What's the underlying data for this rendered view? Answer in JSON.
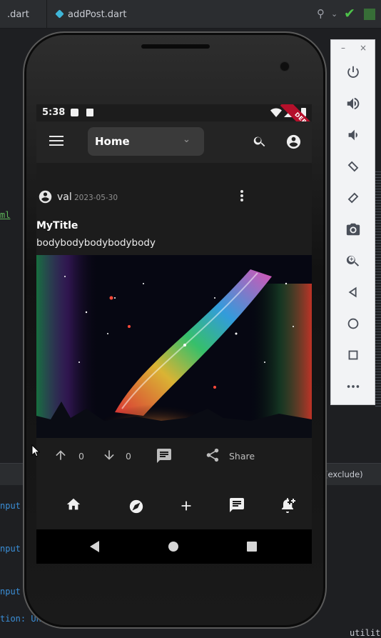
{
  "ide": {
    "tabs": [
      {
        "label": ".dart"
      },
      {
        "label": "addPost.dart"
      }
    ],
    "gutter_text": "ml",
    "bottom_bar_text": "(exclude)",
    "log_lines": [
      "nput",
      "nput",
      "nput",
      "tion: Una"
    ],
    "log_right": "utilit",
    "colors": {
      "editor_bg": "#1e1f22",
      "tab_bg": "#2b2d30",
      "check": "#4ec14a",
      "link": "#3b8fd8"
    }
  },
  "emulator_panel": {
    "window_controls": [
      "–",
      "×"
    ],
    "buttons": [
      "power-icon",
      "volume-up-icon",
      "volume-down-icon",
      "rotate-left-icon",
      "rotate-right-icon",
      "camera-icon",
      "zoom-icon",
      "back-icon",
      "home-icon",
      "overview-icon",
      "more-icon"
    ]
  },
  "status_bar": {
    "time": "5:38",
    "debug_banner": "DEBUG"
  },
  "app_bar": {
    "dropdown_value": "Home"
  },
  "post": {
    "username": "val",
    "date": "2023-05-30",
    "title": "MyTitle",
    "body": "bodybodybodybodybody",
    "upvotes": "0",
    "downvotes": "0",
    "share_label": "Share"
  },
  "bottom_nav": [
    "home-icon",
    "explore-icon",
    "add-icon",
    "chat-icon",
    "notification-add-icon"
  ],
  "system_nav": [
    "back-icon",
    "home-icon",
    "recents-icon"
  ],
  "colors": {
    "app_bg": "#1c1c1c",
    "appbar": "#242424",
    "dropdown": "#3a3a3a",
    "debug": "#b5102b"
  }
}
